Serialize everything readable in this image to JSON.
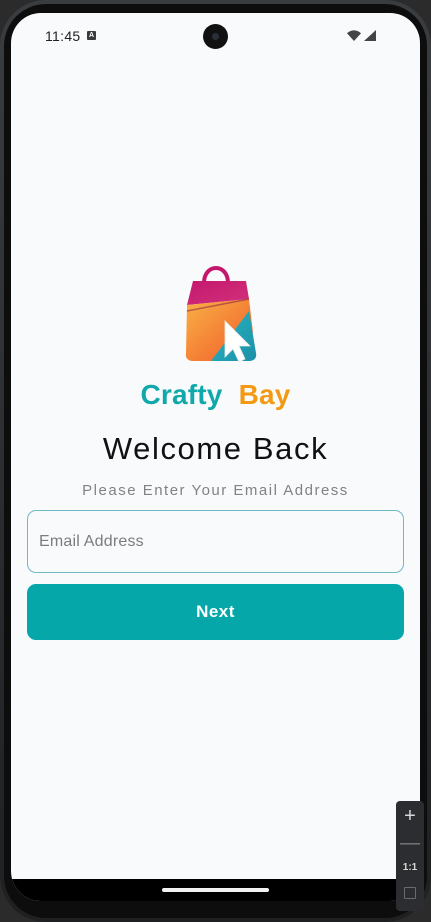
{
  "status_bar": {
    "time": "11:45",
    "notification_icon": "a-letter-icon",
    "icons": [
      "wifi-icon",
      "signal-icon"
    ]
  },
  "logo": {
    "icon": "shopping-bag-cursor-logo",
    "brand_first": "Crafty",
    "brand_second": "Bay",
    "colors": {
      "crafty": "#10a8aa",
      "bay": "#f39a12"
    }
  },
  "login": {
    "title": "Welcome Back",
    "subtitle": "Please Enter Your Email Address",
    "email_placeholder": "Email Address",
    "email_value": "",
    "next_label": "Next"
  },
  "colors": {
    "accent": "#05a7a8",
    "field_border": "#71b8c8",
    "background": "#f8fafb"
  },
  "emulator_controls": {
    "zoom_in": "+",
    "zoom_out": "—",
    "actual_size": "1:1"
  }
}
